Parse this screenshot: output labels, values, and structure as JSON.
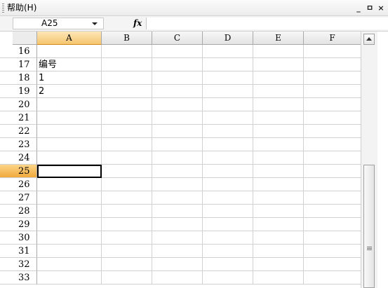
{
  "menubar": {
    "help_label": "帮助(H)"
  },
  "window_controls": {
    "minimize": "_",
    "restore": "ㅁ",
    "close": "×"
  },
  "formula_bar": {
    "name_box": "A25",
    "fx_label": "fx",
    "formula_value": ""
  },
  "columns": [
    "A",
    "B",
    "C",
    "D",
    "E",
    "F"
  ],
  "rows": [
    {
      "num": "16",
      "a": ""
    },
    {
      "num": "17",
      "a": "编号"
    },
    {
      "num": "18",
      "a": "1"
    },
    {
      "num": "19",
      "a": "2"
    },
    {
      "num": "20",
      "a": ""
    },
    {
      "num": "21",
      "a": ""
    },
    {
      "num": "22",
      "a": ""
    },
    {
      "num": "23",
      "a": ""
    },
    {
      "num": "24",
      "a": ""
    },
    {
      "num": "25",
      "a": ""
    },
    {
      "num": "26",
      "a": ""
    },
    {
      "num": "27",
      "a": ""
    },
    {
      "num": "28",
      "a": ""
    },
    {
      "num": "29",
      "a": ""
    },
    {
      "num": "30",
      "a": ""
    },
    {
      "num": "31",
      "a": ""
    },
    {
      "num": "32",
      "a": ""
    },
    {
      "num": "33",
      "a": ""
    }
  ],
  "selection": {
    "column": "A",
    "row": "25"
  },
  "colors": {
    "header_highlight": "#f6c56f",
    "grid_line": "#d0d0d0"
  }
}
